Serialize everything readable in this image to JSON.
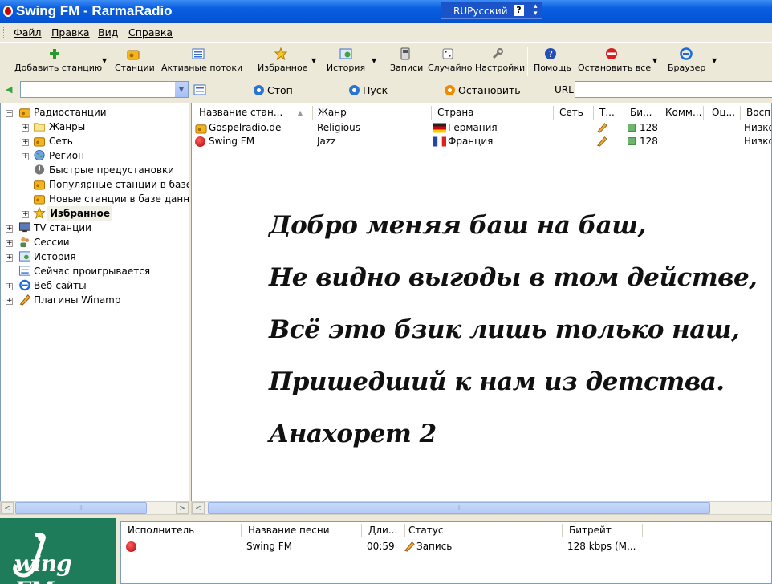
{
  "window": {
    "title": "Swing FM - RarmaRadio",
    "lang_code": "RU",
    "lang_name": "Русский",
    "help": "?"
  },
  "menu": [
    "Файл",
    "Правка",
    "Вид",
    "Справка"
  ],
  "toolbar": {
    "add_station": "Добавить станцию",
    "stations": "Станции",
    "active_streams": "Активные потоки",
    "favorites": "Избранное",
    "history": "История",
    "records": "Записи",
    "random": "Случайно",
    "settings": "Настройки",
    "help": "Помощь",
    "stop_all": "Остановить все",
    "browser": "Браузер"
  },
  "player": {
    "stop": "Стоп",
    "play": "Пуск",
    "pause": "Остановить",
    "url_label": "URL",
    "url_value": "",
    "station_value": ""
  },
  "tree": {
    "radio": "Радиостанции",
    "genres": "Жанры",
    "network": "Сеть",
    "region": "Регион",
    "presets": "Быстрые предустановки",
    "popular": "Популярные станции в базе д",
    "new": "Новые станции в базе данны",
    "favorites": "Избранное",
    "tv": "TV станции",
    "sessions": "Сессии",
    "history": "История",
    "now_playing": "Сейчас проигрывается",
    "websites": "Веб-сайты",
    "winamp": "Плагины Winamp"
  },
  "stations_table": {
    "columns": [
      "Название стан...",
      "Жанр",
      "Страна",
      "Сеть",
      "Т...",
      "Би...",
      "Комм...",
      "Оц...",
      "Воспр"
    ],
    "rows": [
      {
        "name": "Gospelradio.de",
        "genre": "Religious",
        "country": "Германия",
        "bitrate": "128",
        "quality": "Низко"
      },
      {
        "name": "Swing FM",
        "genre": "Jazz",
        "country": "Франция",
        "bitrate": "128",
        "quality": "Низко"
      }
    ]
  },
  "poem": [
    "Добро меняя баш на баш,",
    "Не видно выгоды в том действе,",
    "Всё это бзик лишь только наш,",
    "Пришедший к нам из детства.",
    "Анахорет 2"
  ],
  "playlist": {
    "columns": [
      "Исполнитель",
      "Название песни",
      "Дли...",
      "Статус",
      "Битрейт"
    ],
    "rows": [
      {
        "artist": "",
        "title": "Swing FM",
        "length": "00:59",
        "status": "Запись",
        "bitrate": "128 kbps (M..."
      }
    ]
  },
  "logo_text": "wing FM",
  "colors": {
    "title_blue": "#0556d8",
    "selection": "#f2f0e6",
    "logo_green": "#1e7c5a"
  }
}
